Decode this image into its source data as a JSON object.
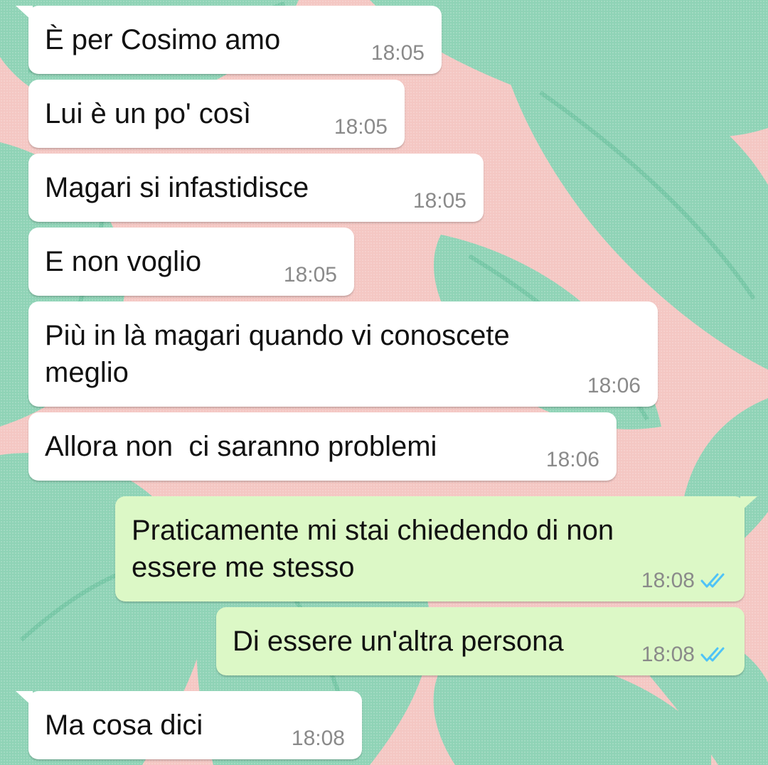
{
  "theme": {
    "incoming_bubble": "#ffffff",
    "outgoing_bubble": "#dcf8c6",
    "read_tick_color": "#4fc3f7",
    "timestamp_color": "#8a8a8a",
    "wallpaper_leaf": "#8fd3b6",
    "wallpaper_bg": "#f4c7c3"
  },
  "messages": [
    {
      "text": "È per Cosimo amo",
      "time": "18:05",
      "direction": "incoming"
    },
    {
      "text": "Lui è un po' così",
      "time": "18:05",
      "direction": "incoming"
    },
    {
      "text": "Magari si infastidisce",
      "time": "18:05",
      "direction": "incoming"
    },
    {
      "text": "E non voglio",
      "time": "18:05",
      "direction": "incoming"
    },
    {
      "text": "Più in là magari quando vi conoscete\nmeglio",
      "time": "18:06",
      "direction": "incoming"
    },
    {
      "text": "Allora non  ci saranno problemi",
      "time": "18:06",
      "direction": "incoming"
    },
    {
      "text": "Praticamente mi stai chiedendo di non\nessere me stesso",
      "time": "18:08",
      "direction": "outgoing",
      "status_icon": "double-check-read-icon"
    },
    {
      "text": "Di essere un'altra persona",
      "time": "18:08",
      "direction": "outgoing",
      "status_icon": "double-check-read-icon"
    },
    {
      "text": "Ma cosa dici",
      "time": "18:08",
      "direction": "incoming"
    }
  ]
}
